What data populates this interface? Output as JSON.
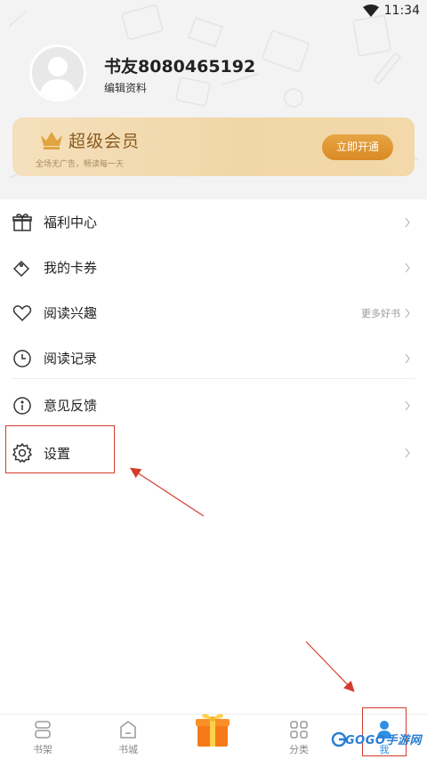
{
  "status": {
    "time": "11:34"
  },
  "profile": {
    "username": "书友8080465192",
    "edit_label": "编辑资料"
  },
  "vip": {
    "title": "超级会员",
    "subtitle": "全场无广告，畅读每一天",
    "button_label": "立即开通",
    "accent": "#d98a25"
  },
  "menu": {
    "items": [
      {
        "label": "福利中心",
        "icon": "gift-icon",
        "extra": ""
      },
      {
        "label": "我的卡券",
        "icon": "ticket-icon",
        "extra": ""
      },
      {
        "label": "阅读兴趣",
        "icon": "heart-icon",
        "extra": "更多好书"
      },
      {
        "label": "阅读记录",
        "icon": "clock-icon",
        "extra": ""
      },
      {
        "label": "意见反馈",
        "icon": "info-icon",
        "extra": ""
      },
      {
        "label": "设置",
        "icon": "gear-icon",
        "extra": ""
      }
    ]
  },
  "tabbar": {
    "items": [
      {
        "label": "书架",
        "icon": "bookshelf-icon"
      },
      {
        "label": "书城",
        "icon": "bookstore-icon"
      },
      {
        "label": "",
        "icon": "gift-box-icon"
      },
      {
        "label": "分类",
        "icon": "category-icon"
      },
      {
        "label": "我",
        "icon": "person-icon"
      }
    ]
  },
  "watermark": {
    "text": "GOGO手游网"
  },
  "annotation_color": "#d43b2c"
}
